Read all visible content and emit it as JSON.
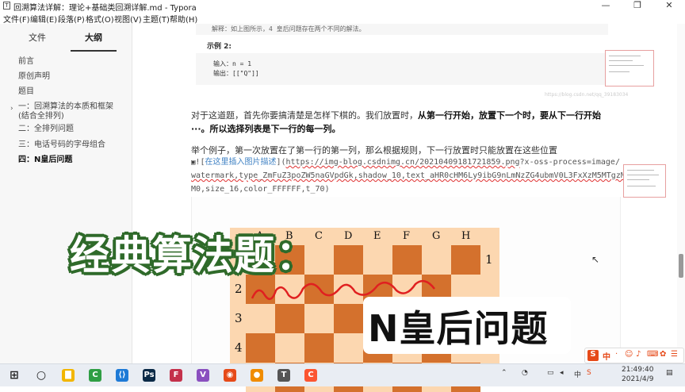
{
  "window": {
    "title": "回溯算法详解：理论+基础类回溯详解.md - Typora",
    "controls": {
      "minimize": "—",
      "maximize": "❐",
      "close": "✕"
    }
  },
  "menu": [
    "文件(F)",
    "编辑(E)",
    "段落(P)",
    "格式(O)",
    "视图(V)",
    "主题(T)",
    "帮助(H)"
  ],
  "sidebar": {
    "tabs": [
      "文件",
      "大纲"
    ],
    "active_tab": "大纲",
    "outline": [
      {
        "label": "前言"
      },
      {
        "label": "原创声明"
      },
      {
        "label": "题目"
      },
      {
        "label": "一：回溯算法的本质和框架(结合全排列)"
      },
      {
        "label": "二：全排列问题"
      },
      {
        "label": "三：电话号码的字母组合"
      },
      {
        "label": "四：N皇后问题"
      }
    ],
    "footer": {
      "back": "‹",
      "source": "</>"
    }
  },
  "content": {
    "top_note": "解释：如上图所示，4 皇后问题存在两个不同的解法。",
    "example_heading": "示例 2:",
    "example_code": [
      "输入：n = 1",
      "输出：[[\"Q\"]]"
    ],
    "para1_a": "对于这道题，首先你要搞清楚是怎样下棋的。我们放置时，",
    "para1_b": "从第一行开始，放置下一个时，要从下一行开始···。所以选择列表是下一行的每一列。",
    "para2": "举个例子，第一次放置在了第一行的第一列，那么根据规则，下一行放置时只能放置在这些位置",
    "image_md": {
      "prefix": "![",
      "alt": "在这里插入图片描述",
      "mid": "](",
      "url_part1": "https://img-blog.csdnimg.cn/20210409181721859.png",
      "url_part2": "?x-oss-process=image/",
      "line2": "watermark,type_ZmFuZ3poZW5naGVpdGk,shadow_10,text_aHR0cHM6Ly9ibG9nLmNzZG4ubmV0L3FxXzM5MTgzMD",
      "line3": "M0,size_16,color_FFFFFF,t_70)"
    },
    "watermark": "https://blog.csdn.net/qq_39183034"
  },
  "board": {
    "files": [
      "A",
      "B",
      "C",
      "D",
      "E",
      "F",
      "G",
      "H"
    ],
    "ranks": [
      "1",
      "2",
      "3",
      "4"
    ],
    "light": "#fcd7b0",
    "dark": "#d4712d",
    "frame": "#6b3a16"
  },
  "overlay": {
    "title": "经典算法题：",
    "subtitle": "N皇后问题"
  },
  "ime_bar": {
    "logo": "S",
    "lang": "中"
  },
  "taskbar": {
    "apps": [
      {
        "name": "start-icon",
        "glyph": "⊞",
        "color": "#1f1f1f"
      },
      {
        "name": "search-icon",
        "glyph": "○",
        "color": "#1f1f1f"
      },
      {
        "name": "file-explorer-icon",
        "glyph": "▇",
        "color": "#f2b600"
      },
      {
        "name": "camtasia-icon",
        "glyph": "C",
        "color": "#2f9e44"
      },
      {
        "name": "vscode-icon",
        "glyph": "⟨⟩",
        "color": "#1e7ad6"
      },
      {
        "name": "photoshop-icon",
        "glyph": "Ps",
        "color": "#0b2a47"
      },
      {
        "name": "flowchart-icon",
        "glyph": "F",
        "color": "#c4314b"
      },
      {
        "name": "visual-studio-icon",
        "glyph": "V",
        "color": "#8a4fbf"
      },
      {
        "name": "chrome-icon",
        "glyph": "◉",
        "color": "#e64a19"
      },
      {
        "name": "recorder-icon",
        "glyph": "●",
        "color": "#f08c00"
      },
      {
        "name": "typora-icon",
        "glyph": "T",
        "color": "#555555"
      },
      {
        "name": "csdn-icon",
        "glyph": "C",
        "color": "#fc5531"
      }
    ],
    "time": "21:49:40",
    "date": "2021/4/9"
  }
}
